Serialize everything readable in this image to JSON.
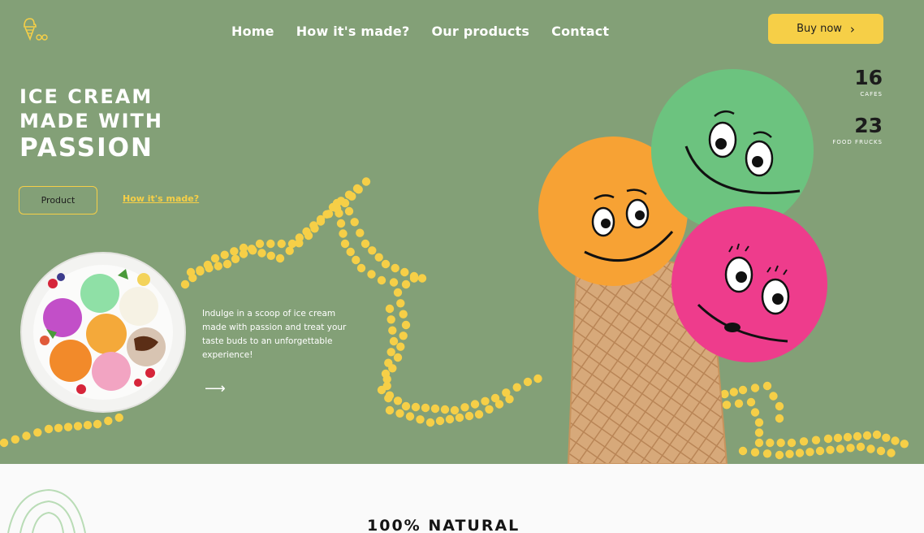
{
  "nav": {
    "items": [
      {
        "label": "Home"
      },
      {
        "label": "How it's made?"
      },
      {
        "label": "Our products"
      },
      {
        "label": "Contact"
      }
    ],
    "buy_label": "Buy now"
  },
  "hero": {
    "headline": [
      "ICE CREAM",
      "MADE WITH",
      "PASSION"
    ],
    "product_button": "Product",
    "how_link": "How it's made?",
    "description": "Indulge in a scoop of ice cream made with passion and treat your taste buds to an unforgettable experience!",
    "arrow": "⟶"
  },
  "stats": [
    {
      "value": "16",
      "label": "CAFES"
    },
    {
      "value": "23",
      "label": "FOOD FRUCKS"
    }
  ],
  "section": {
    "title": "100% NATURAL"
  },
  "colors": {
    "hero_bg": "#83a077",
    "accent_yellow": "#f6cf47",
    "scoop_green": "#6cc37f",
    "scoop_orange": "#f7a234",
    "scoop_pink": "#ee3c8c"
  },
  "icons": {
    "logo": "ice-cream-logo-icon",
    "buy_chevron": "chevron-right-icon",
    "next_arrow": "arrow-right-icon"
  }
}
